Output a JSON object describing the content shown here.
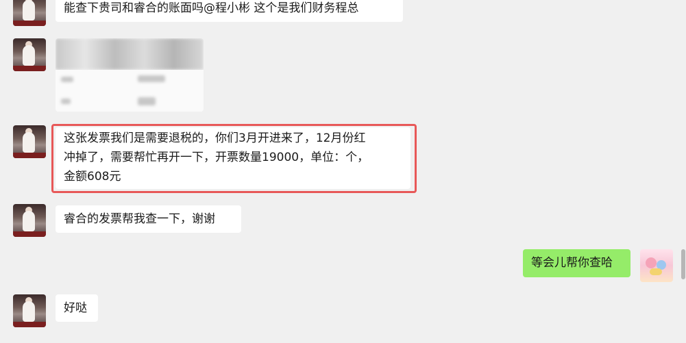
{
  "messages": {
    "m1": "能查下贵司和睿合的账面吗@程小彬 这个是我们财务程总",
    "m3_line1": "这张发票我们是需要退税的，你们3月开进来了，12月份红",
    "m3_line2": "冲掉了，需要帮忙再开一下，开票数量19000，单位：个，",
    "m3_line3": "金额608元",
    "m4": "睿合的发票帮我查一下，谢谢",
    "m5": "等会儿帮你查哈",
    "m6": "好哒"
  },
  "colors": {
    "background": "#f0f0f0",
    "incoming_bubble": "#ffffff",
    "outgoing_bubble": "#95ec69",
    "highlight_border": "#e85858"
  }
}
